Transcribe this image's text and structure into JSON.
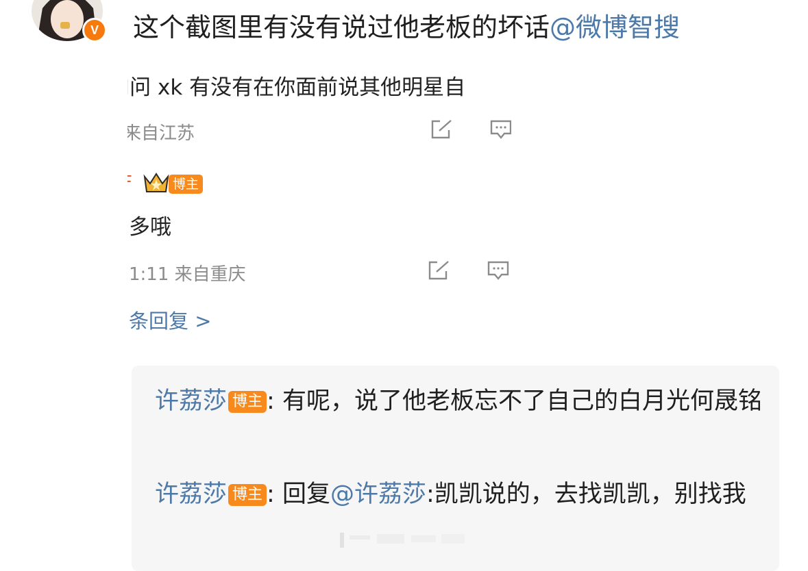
{
  "post": {
    "text": "这个截图里有没有说过他老板的坏话",
    "mention": "@微博智搜",
    "verified_badge": "V"
  },
  "screenshot": {
    "comment1": {
      "text": "J问 xk 有没有在你面前说其他明星自",
      "meta": "来自江苏"
    },
    "comment2": {
      "name_fragment": "F",
      "tag": "博主",
      "text": "多哦",
      "meta": "1:11 来自重庆"
    },
    "more_replies": "条回复 >",
    "icons": [
      "share-icon",
      "comment-icon"
    ]
  },
  "replies": [
    {
      "author": "许荔莎",
      "tag": "博主",
      "sep": ": ",
      "text": "有呢，说了他老板忘不了自己的白月光何晟铭"
    },
    {
      "author": "许荔莎",
      "tag": "博主",
      "sep": ": ",
      "prefix": "回复",
      "mention": "@许荔莎",
      "text": ":凯凯说的，去找凯凯，别找我"
    }
  ],
  "colors": {
    "link": "#4d79a9",
    "tag_bg": "#f88a1d",
    "badge": "#f77a0e",
    "reply_bg": "#f6f6f6",
    "meta": "#8b8b8b"
  }
}
